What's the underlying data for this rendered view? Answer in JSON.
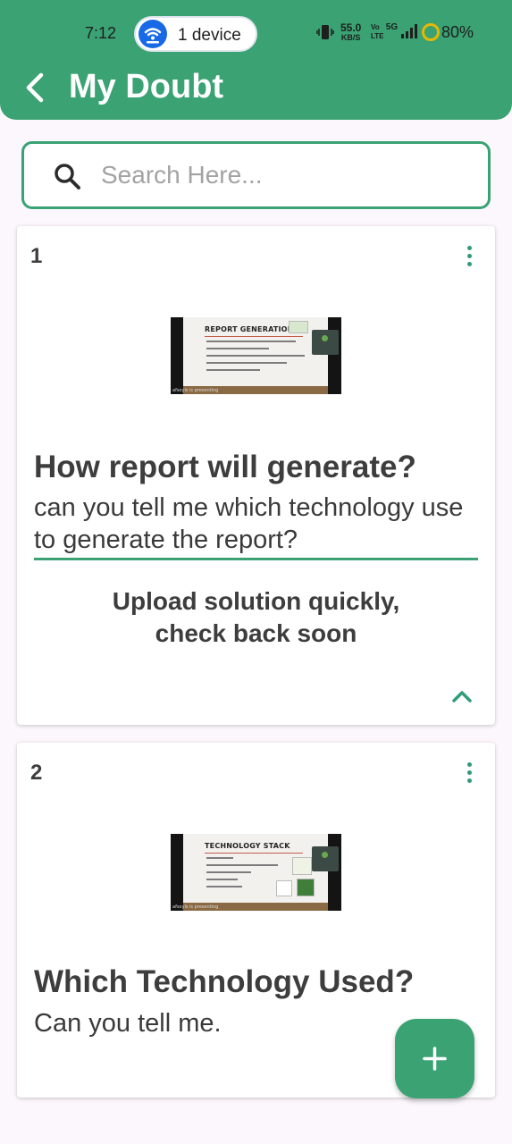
{
  "status_bar": {
    "time": "7:12",
    "hotspot_label": "1 device",
    "speed_value": "55.0",
    "speed_unit": "KB/S",
    "network_volte": "Vo LTE",
    "network_5g": "5G",
    "battery": "80%"
  },
  "header": {
    "title": "My Doubt"
  },
  "search": {
    "placeholder": "Search Here...",
    "value": ""
  },
  "doubts": [
    {
      "number": "1",
      "title": "How report will generate?",
      "description": "can you tell me which technology use to generate the report?",
      "thumbnail": {
        "heading": "REPORT GENERATION",
        "caption": "afsoyls is presenting"
      },
      "solution_message_line1": "Upload solution quickly,",
      "solution_message_line2": "check back soon"
    },
    {
      "number": "2",
      "title": "Which Technology Used?",
      "description": "Can you tell me.",
      "thumbnail": {
        "heading": "TECHNOLOGY STACK",
        "caption": "afsoyls is presenting"
      }
    }
  ],
  "colors": {
    "primary": "#3aa273",
    "accent_icon": "#2e9c7a",
    "background": "#fcf7fc",
    "text": "#3d3d3d"
  },
  "icons": {
    "back": "chevron-left-icon",
    "search": "search-icon",
    "menu": "more-vertical-icon",
    "collapse": "chevron-up-icon",
    "add": "plus-icon"
  }
}
